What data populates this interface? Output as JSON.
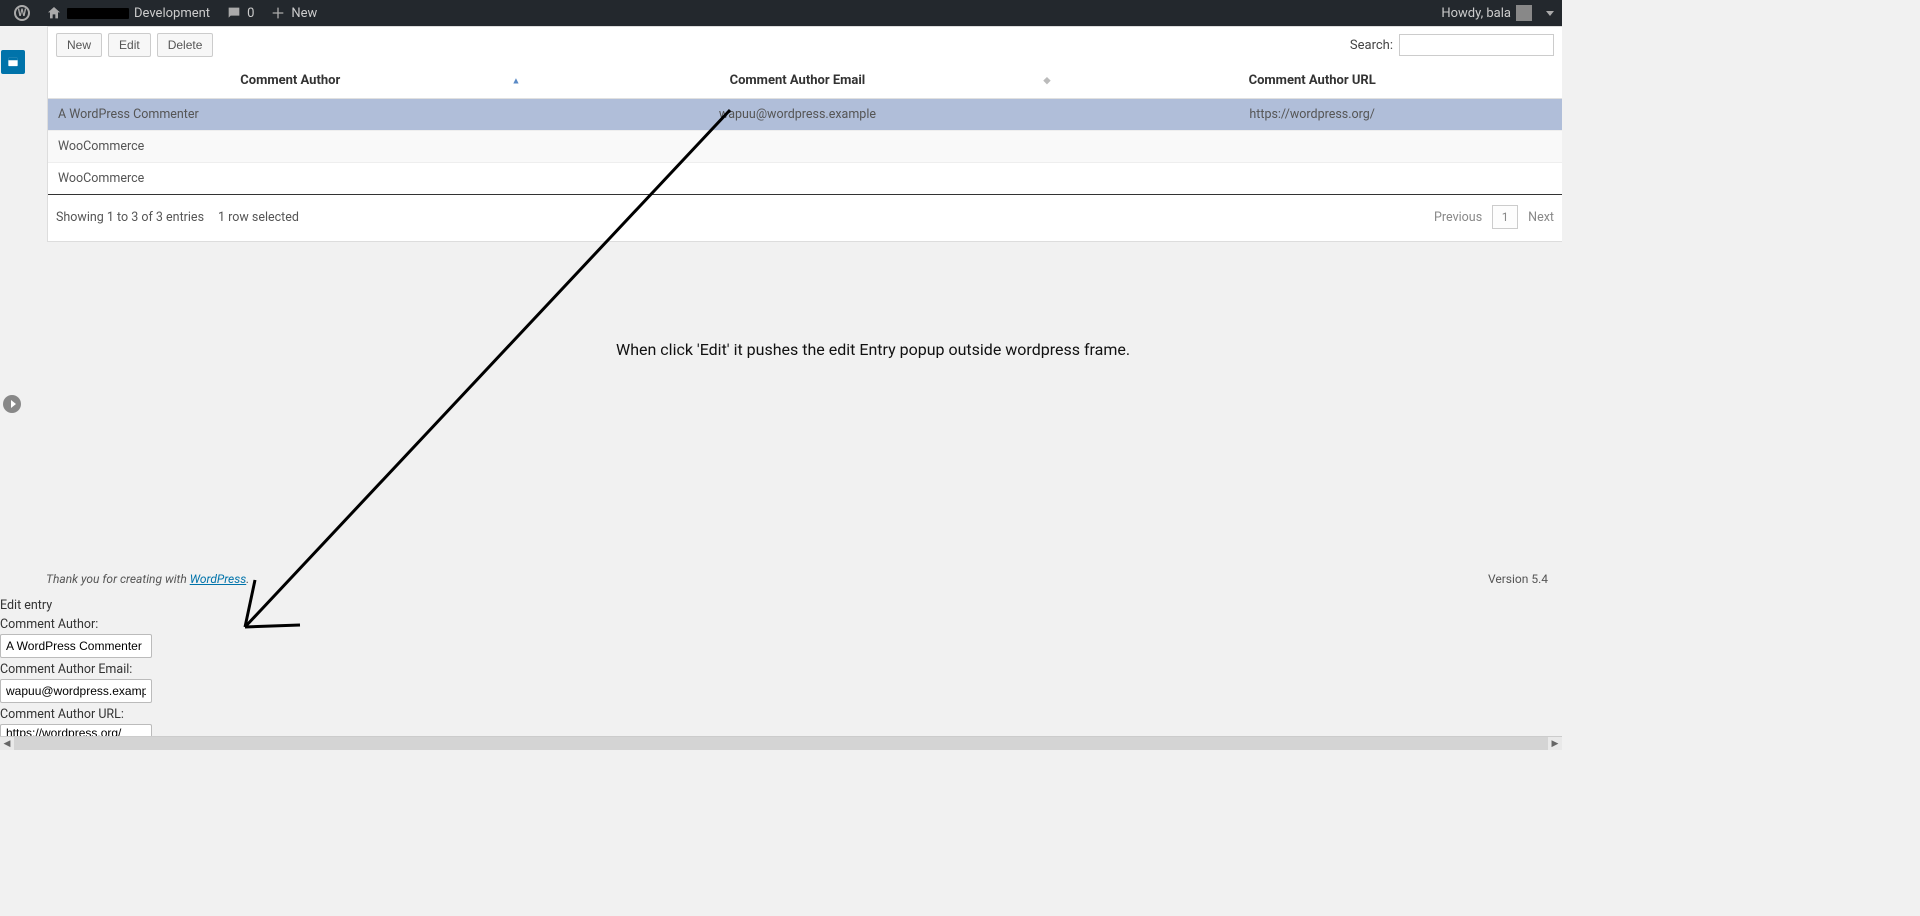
{
  "adminbar": {
    "site_suffix": "Development",
    "comments_count": "0",
    "new_label": "New",
    "howdy": "Howdy, bala"
  },
  "toolbar": {
    "new_label": "New",
    "edit_label": "Edit",
    "delete_label": "Delete",
    "search_label": "Search:",
    "search_value": ""
  },
  "table": {
    "headers": {
      "author": "Comment Author",
      "email": "Comment Author Email",
      "url": "Comment Author URL"
    },
    "rows": [
      {
        "author": "A WordPress Commenter",
        "email": "wapuu@wordpress.example",
        "url": "https://wordpress.org/",
        "selected": true
      },
      {
        "author": "WooCommerce",
        "email": "",
        "url": "",
        "selected": false
      },
      {
        "author": "WooCommerce",
        "email": "",
        "url": "",
        "selected": false
      }
    ],
    "info_entries": "Showing 1 to 3 of 3 entries",
    "info_selected": "1 row selected",
    "prev": "Previous",
    "page": "1",
    "next": "Next"
  },
  "annotation": {
    "text": "When click 'Edit' it pushes the edit Entry popup outside wordpress frame."
  },
  "footer": {
    "thanks_prefix": "Thank you for creating with ",
    "wp_link": "WordPress",
    "version": "Version 5.4"
  },
  "editform": {
    "title": "Edit entry",
    "author_label": "Comment Author:",
    "author_value": "A WordPress Commenter",
    "email_label": "Comment Author Email:",
    "email_value": "wapuu@wordpress.examp",
    "url_label": "Comment Author URL:",
    "url_value": "https://wordpress.org/"
  }
}
